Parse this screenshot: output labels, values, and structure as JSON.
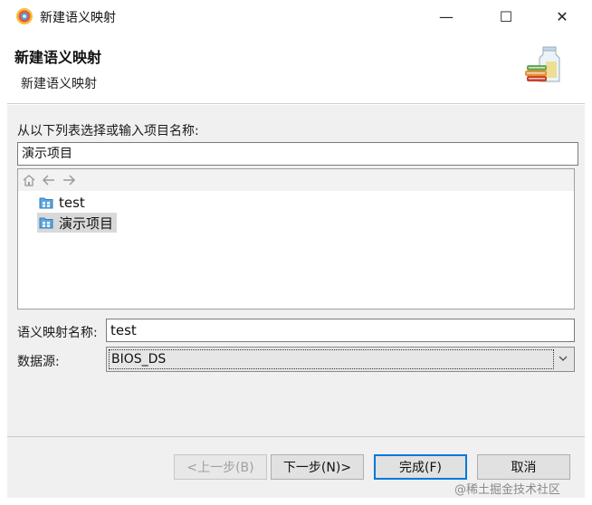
{
  "window": {
    "title": "新建语义映射",
    "minimize_glyph": "—",
    "maximize_glyph": "☐",
    "close_glyph": "✕"
  },
  "banner": {
    "title": "新建语义映射",
    "subtitle": "新建语义映射"
  },
  "project": {
    "label": "从以下列表选择或输入项目名称:",
    "value": "演示项目",
    "tree": [
      {
        "label": "test",
        "selected": false
      },
      {
        "label": "演示项目",
        "selected": true
      }
    ]
  },
  "mapping_name": {
    "label": "语义映射名称:",
    "value": "test"
  },
  "data_source": {
    "label": "数据源:",
    "value": "BIOS_DS"
  },
  "buttons": {
    "back": "<上一步(B)",
    "next": "下一步(N)>",
    "finish": "完成(F)",
    "cancel": "取消"
  },
  "watermark": "@稀土掘金技术社区",
  "colors": {
    "accent": "#0078d7",
    "folder": "#2e7fc0",
    "selection": "#d9d9d9"
  }
}
